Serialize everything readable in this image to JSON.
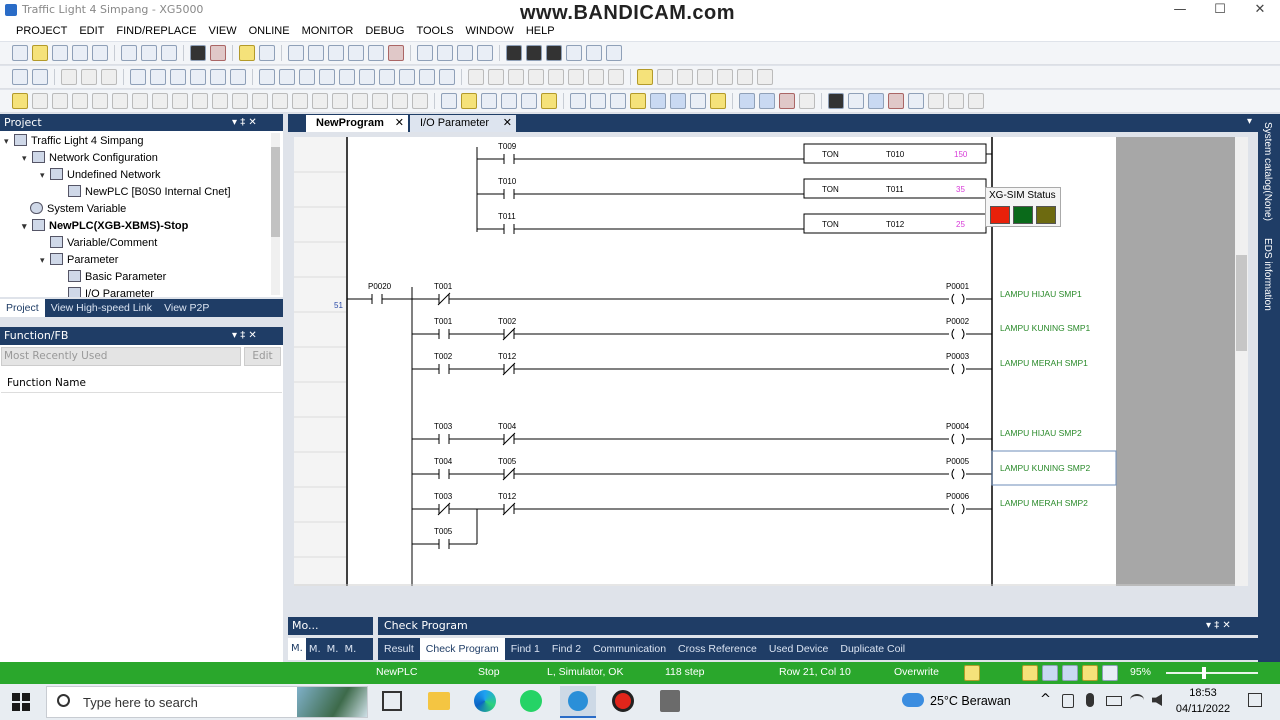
{
  "window": {
    "title": "Traffic Light 4 Simpang - XG5000",
    "watermark": "www.BANDICAM.com",
    "controls": [
      "—",
      "☐",
      "✕"
    ]
  },
  "menu": [
    "PROJECT",
    "EDIT",
    "FIND/REPLACE",
    "VIEW",
    "ONLINE",
    "MONITOR",
    "DEBUG",
    "TOOLS",
    "WINDOW",
    "HELP"
  ],
  "project_panel": {
    "title": "Project",
    "ctl_pin": "▾ ‡ ✕",
    "tree": [
      {
        "label": "Traffic Light 4 Simpang",
        "arrow": "▾"
      },
      {
        "label": "Network Configuration",
        "arrow": "▾"
      },
      {
        "label": "Undefined Network",
        "arrow": "▾"
      },
      {
        "label": "NewPLC [B0S0 Internal Cnet]",
        "arrow": ""
      },
      {
        "label": "System Variable",
        "arrow": ""
      },
      {
        "label": "NewPLC(XGB-XBMS)-Stop",
        "arrow": "▾"
      },
      {
        "label": "Variable/Comment",
        "arrow": ""
      },
      {
        "label": "Parameter",
        "arrow": "▾"
      },
      {
        "label": "Basic Parameter",
        "arrow": ""
      },
      {
        "label": "I/O Parameter",
        "arrow": ""
      }
    ],
    "tabs": [
      "Project",
      "View High-speed Link",
      "View P2P"
    ]
  },
  "function_panel": {
    "title": "Function/FB",
    "ctl_pin": "▾ ‡ ✕",
    "dropdown": "Most Recently Used",
    "edit_btn": "Edit",
    "column": "Function Name"
  },
  "editor": {
    "tabs": [
      {
        "label": "NewProgram",
        "close": "✕"
      },
      {
        "label": "I/O Parameter",
        "close": "✕"
      }
    ],
    "menu_arrow": "▾",
    "line_number": "51",
    "timers": [
      {
        "contact": "T009",
        "type": "TON",
        "timer": "T010",
        "preset": "150"
      },
      {
        "contact": "T010",
        "type": "TON",
        "timer": "T011",
        "preset": "35"
      },
      {
        "contact": "T011",
        "type": "TON",
        "timer": "T012",
        "preset": "25"
      }
    ],
    "rungs": [
      {
        "c1": "P0020",
        "c2": "T001",
        "coil": "P0001",
        "lamp": "LAMPU HIJAU SMP1"
      },
      {
        "c1": "T001",
        "c2": "T002",
        "coil": "P0002",
        "lamp": "LAMPU KUNING SMP1"
      },
      {
        "c1": "T002",
        "c2": "T012",
        "coil": "P0003",
        "lamp": "LAMPU MERAH SMP1"
      },
      {
        "c1": "T003",
        "c2": "T004",
        "coil": "P0004",
        "lamp": "LAMPU HIJAU SMP2"
      },
      {
        "c1": "T004",
        "c2": "T005",
        "coil": "P0005",
        "lamp": "LAMPU KUNING SMP2"
      },
      {
        "c1": "T003",
        "c2": "T012",
        "coil": "P0006",
        "lamp": "LAMPU MERAH SMP2"
      }
    ],
    "branch_contact": "T005"
  },
  "xgsim": {
    "title": "XG-SIM Status",
    "lights": [
      "#e8210a",
      "#0a6a1a",
      "#6d6a10"
    ]
  },
  "right_sidebar": [
    "System catalog(None)",
    "EDS information"
  ],
  "bottom_panels": {
    "left_title": "Mo...",
    "left_tabs": [
      "M.",
      "M.",
      "M.",
      "M."
    ],
    "right_title": "Check Program",
    "ctl_pin": "▾ ‡ ✕",
    "tabs": [
      "Result",
      "Check Program",
      "Find 1",
      "Find 2",
      "Communication",
      "Cross Reference",
      "Used Device",
      "Duplicate Coil"
    ]
  },
  "statusbar": {
    "plc": "NewPLC",
    "state": "Stop",
    "connection": "L, Simulator, OK",
    "steps": "118 step",
    "position": "Row 21, Col 10",
    "mode": "Overwrite",
    "zoom": "95%"
  },
  "taskbar": {
    "search_placeholder": "Type here to search",
    "weather": "25°C  Berawan",
    "time": "18:53",
    "date": "04/11/2022",
    "tray_arrow": "^"
  }
}
